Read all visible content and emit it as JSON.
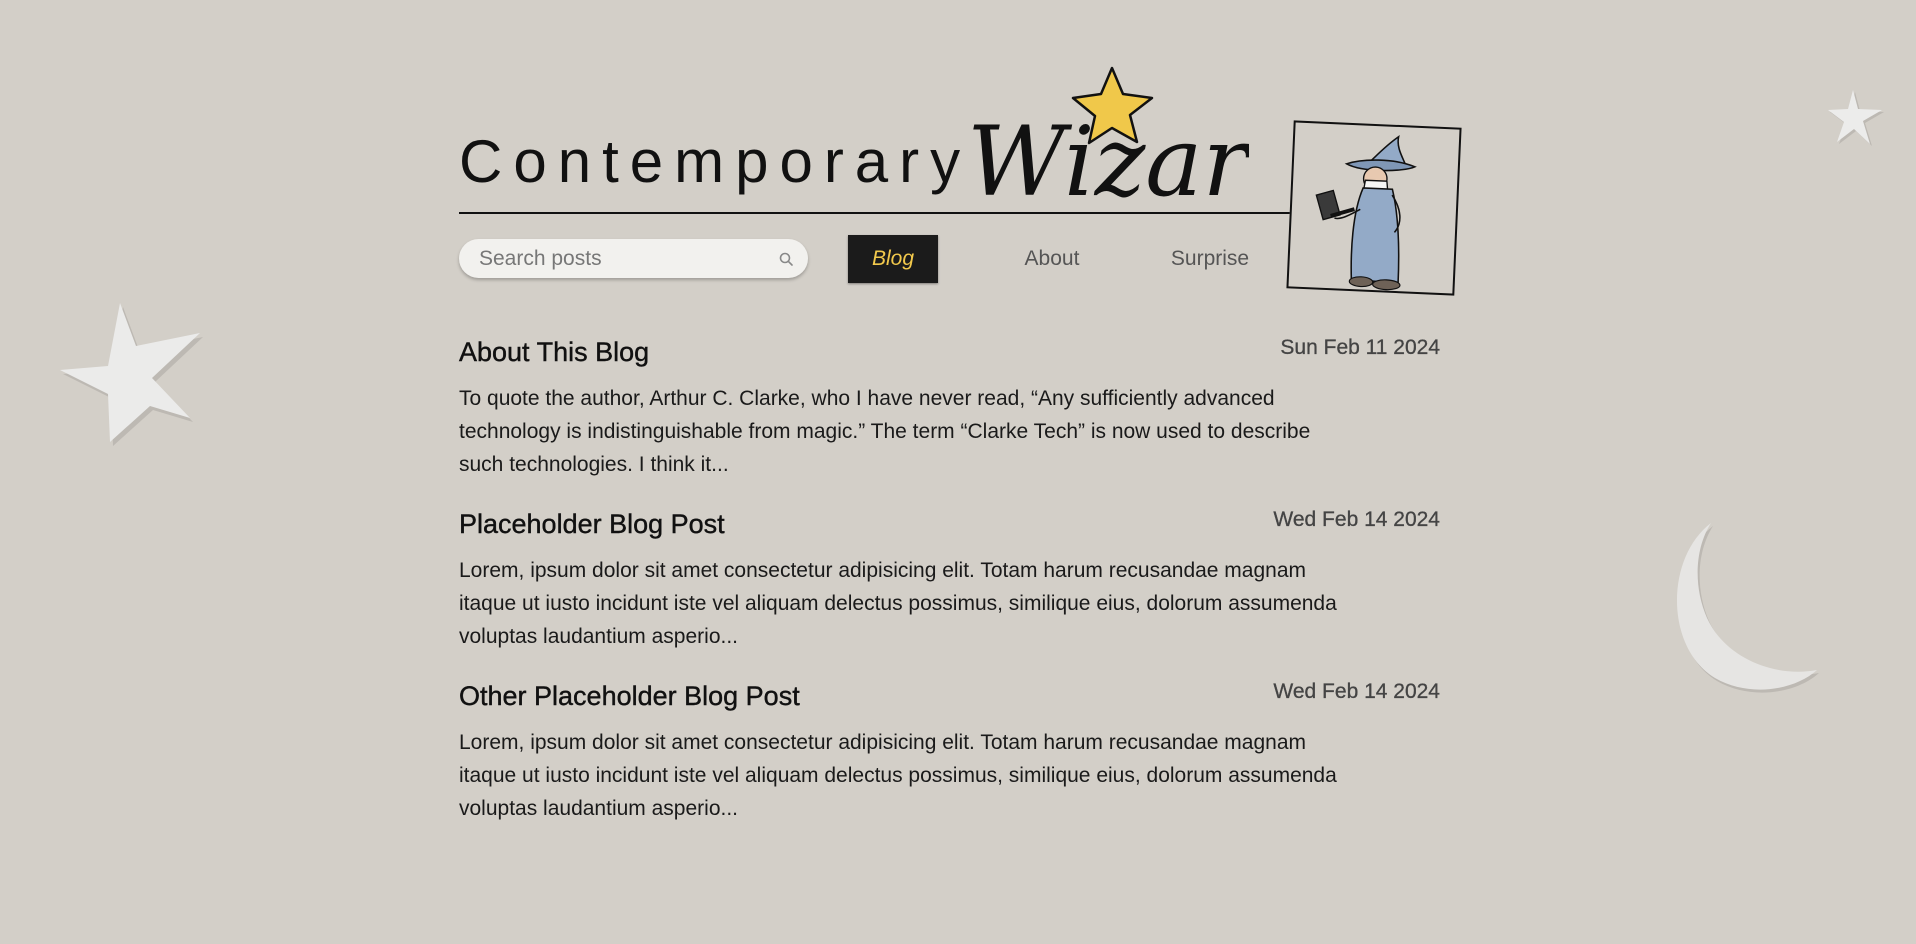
{
  "site": {
    "title_plain": "Contemporary",
    "title_script": "Wizard"
  },
  "search": {
    "placeholder": "Search posts",
    "icon": "search-icon"
  },
  "nav": {
    "items": [
      {
        "label": "Blog",
        "active": true
      },
      {
        "label": "About",
        "active": false
      },
      {
        "label": "Surprise",
        "active": false
      }
    ]
  },
  "posts": [
    {
      "title": "About This Blog",
      "date": "Sun Feb 11 2024",
      "excerpt": "To quote the author, Arthur C. Clarke, who I have never read, “Any sufficiently advanced technology is indistinguishable from magic.” The term “Clarke Tech” is now used to describe such technologies. I think it..."
    },
    {
      "title": "Placeholder Blog Post",
      "date": "Wed Feb 14 2024",
      "excerpt": "Lorem, ipsum dolor sit amet consectetur adipisicing elit. Totam harum recusandae magnam itaque ut iusto incidunt iste vel aliquam delectus possimus, similique eius, dolorum assumenda voluptas laudantium asperio..."
    },
    {
      "title": "Other Placeholder Blog Post",
      "date": "Wed Feb 14 2024",
      "excerpt": "Lorem, ipsum dolor sit amet consectetur adipisicing elit. Totam harum recusandae magnam itaque ut iusto incidunt iste vel aliquam delectus possimus, similique eius, dolorum assumenda voluptas laudantium asperio..."
    }
  ],
  "colors": {
    "background": "#d3cfc8",
    "active_nav_bg": "#1b1b1b",
    "active_nav_text": "#f2c94c",
    "star_yellow": "#f0c84a",
    "wizard_robe": "#93aac7"
  },
  "decorations": [
    "star-icon",
    "star-icon",
    "moon-icon",
    "wizard-illustration"
  ]
}
